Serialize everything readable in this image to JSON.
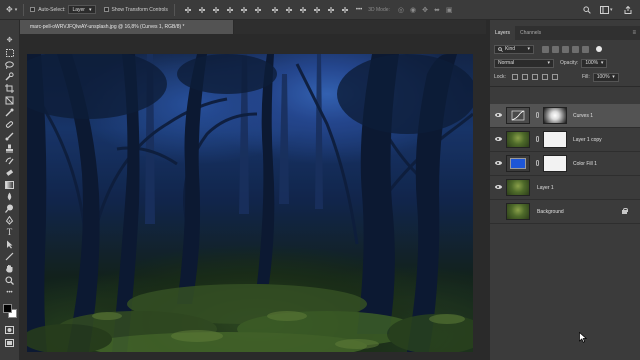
{
  "options_bar": {
    "auto_select_label": "Auto-Select:",
    "auto_select_value": "Layer",
    "show_transform_label": "Show Transform Controls",
    "three_d_mode_label": "3D Mode:"
  },
  "document": {
    "tab_title": "marc-pell-oWRVJFQIwAY-unsplash.jpg @ 16,8% (Curves 1, RGB/8) *"
  },
  "layers_panel": {
    "tabs": [
      "Layers",
      "Channels"
    ],
    "filter_kind": "Kind",
    "blend_mode": "Normal",
    "opacity_label": "Opacity:",
    "opacity_value": "100%",
    "lock_label": "Lock:",
    "fill_label": "Fill:",
    "fill_value": "100%",
    "layers": [
      {
        "name": "Curves 1",
        "visible": true,
        "selected": true
      },
      {
        "name": "Layer 1 copy",
        "visible": true,
        "selected": false
      },
      {
        "name": "Color Fill 1",
        "visible": true,
        "selected": false
      },
      {
        "name": "Layer 1",
        "visible": true,
        "selected": false
      },
      {
        "name": "Background",
        "visible": false,
        "selected": false,
        "locked": true
      }
    ]
  },
  "colors": {
    "color_fill": "#1e56d6",
    "foreground": "#000000",
    "background": "#ffffff"
  }
}
